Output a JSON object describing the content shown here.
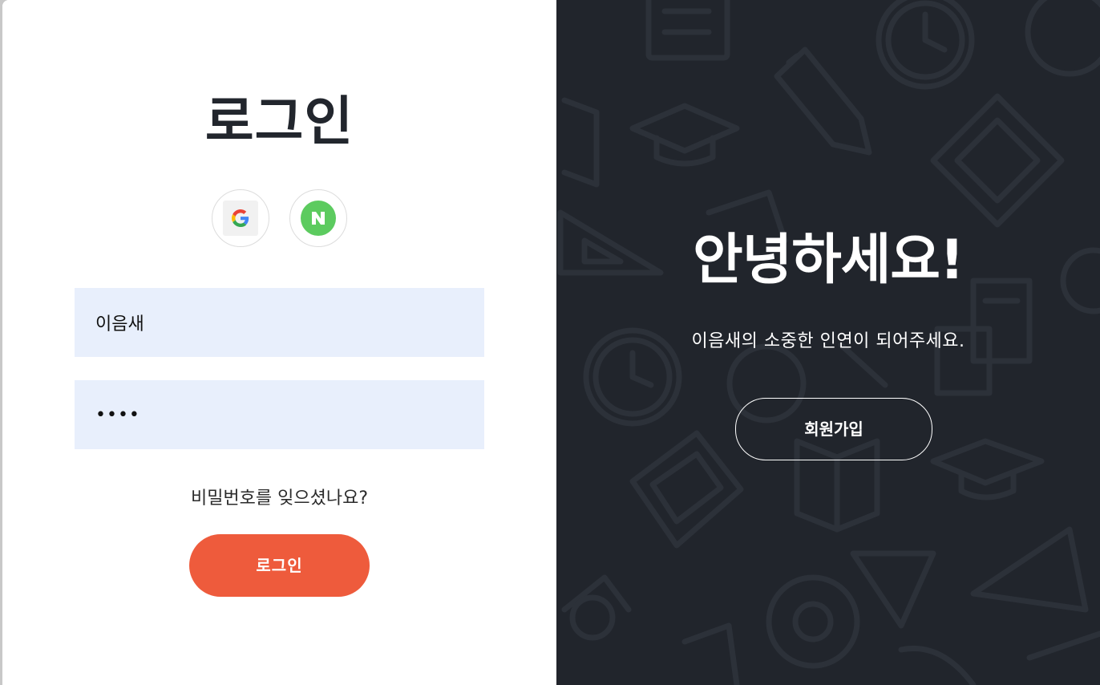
{
  "login": {
    "title": "로그인",
    "social": [
      {
        "name": "google",
        "icon": "google-icon"
      },
      {
        "name": "naver",
        "icon": "naver-icon",
        "color": "#5ccb5f"
      }
    ],
    "id_value": "이음새",
    "password_value": "••••",
    "forgot_label": "비밀번호를 잊으셨나요?",
    "button_label": "로그인",
    "button_color": "#ee5b3c"
  },
  "welcome": {
    "title": "안녕하세요!",
    "subtitle": "이음새의 소중한 인연이 되어주세요.",
    "signup_label": "회원가입",
    "background_color": "#21252c"
  }
}
